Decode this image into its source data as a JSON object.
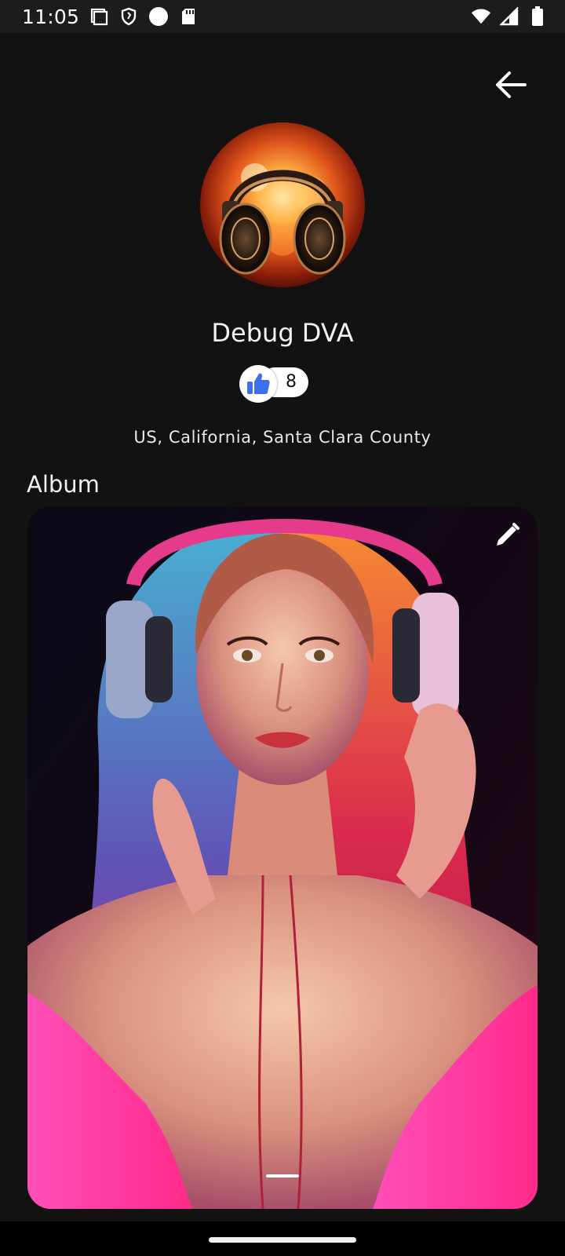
{
  "status_bar": {
    "time": "11:05",
    "left_icons": [
      "screenshot-icon",
      "shield-icon",
      "circle-icon",
      "sd-card-icon"
    ],
    "right_icons": [
      "wifi-icon",
      "cell-signal-icon",
      "battery-icon"
    ]
  },
  "header": {
    "back_icon": "arrow-back-icon"
  },
  "profile": {
    "name": "Debug DVA",
    "likes": "8",
    "location": "US, California, Santa Clara County",
    "avatar_icon": "headphones-fire-image"
  },
  "album": {
    "title": "Album",
    "edit_icon": "pencil-icon",
    "photo": "woman-headphones-photo"
  },
  "colors": {
    "background": "#121212",
    "status_bar": "#1c1c1e",
    "like_blue": "#3f6fe8",
    "text": "#ffffff"
  }
}
